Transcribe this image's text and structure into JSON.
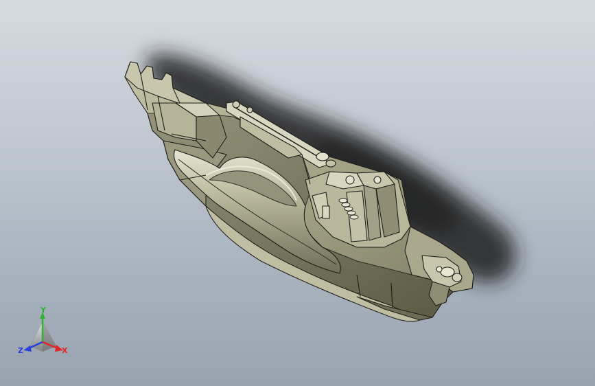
{
  "viewport": {
    "background_top": "#d5dae0",
    "background_bottom": "#98a3b0",
    "model_color": "#a8a78a",
    "edge_color": "#1e1e1a"
  },
  "triad": {
    "x_label": "X",
    "y_label": "Y",
    "z_label": "Z",
    "x_color": "#e0282a",
    "y_color": "#2fb336",
    "z_color": "#2a3fd8"
  }
}
